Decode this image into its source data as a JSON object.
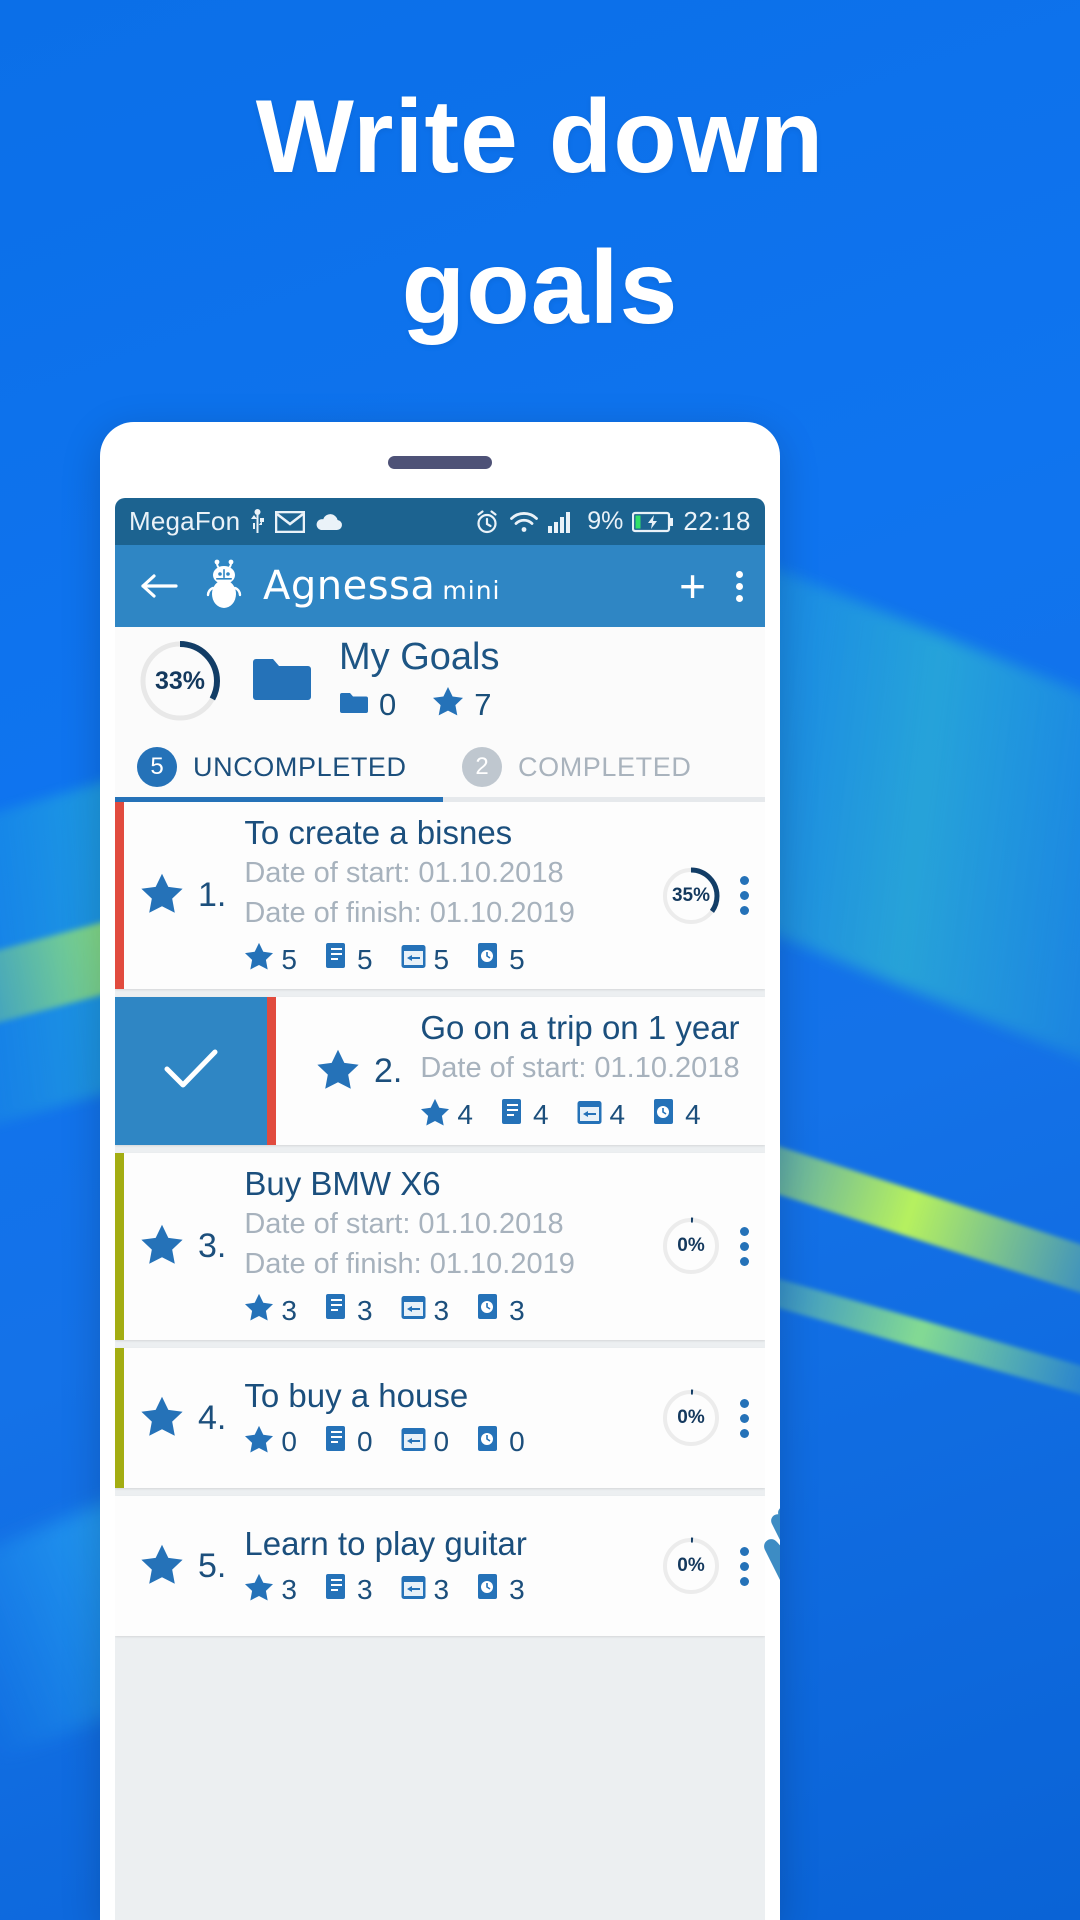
{
  "promo": {
    "headline_line1": "Write down",
    "headline_line2": "goals",
    "bg_color": "#0f74ef",
    "text_color": "#ffffff"
  },
  "statusbar": {
    "carrier": "MegaFon",
    "icons_left": [
      "usb-icon",
      "email-icon",
      "cloud-icon"
    ],
    "icons_right": [
      "alarm-icon",
      "wifi-icon",
      "signal-icon"
    ],
    "battery_percent": "9%",
    "battery_icon": "battery-charging-icon",
    "clock": "22:18",
    "bg_color": "#1c6390"
  },
  "appbar": {
    "back_icon": "back-arrow-icon",
    "logo_icon": "robot-logo-icon",
    "brand": "Agnessa",
    "brand_suffix": "mini",
    "add_label": "+",
    "overflow_icon": "overflow-menu-icon",
    "bg_color": "#2f86c4"
  },
  "goals_header": {
    "progress_percent": 33,
    "progress_label": "33%",
    "folder_icon": "folder-icon",
    "title": "My Goals",
    "subfolders_icon": "folder-icon",
    "subfolders_count": "0",
    "stars_icon": "star-icon",
    "stars_count": "7"
  },
  "tabs": [
    {
      "badge": "5",
      "label": "UNCOMPLETED",
      "active": true
    },
    {
      "badge": "2",
      "label": "COMPLETED",
      "active": false
    }
  ],
  "goals": [
    {
      "index": "1.",
      "title": "To create a bisnes",
      "date_start": "Date of start: 01.10.2018",
      "date_finish": "Date of finish: 01.10.2019",
      "counts": {
        "star": "5",
        "note": "5",
        "calendar": "5",
        "task": "5"
      },
      "progress_percent": 35,
      "progress_label": "35%",
      "edge_color": "red",
      "swiped": false
    },
    {
      "index": "2.",
      "title": "Go on a trip on 1 year",
      "date_start": "Date of start: 01.10.2018",
      "date_finish": "",
      "counts": {
        "star": "4",
        "note": "4",
        "calendar": "4",
        "task": "4"
      },
      "progress_percent": null,
      "progress_label": "",
      "edge_color": "red",
      "swiped": true,
      "swipe_action_icon": "check-icon"
    },
    {
      "index": "3.",
      "title": "Buy BMW X6",
      "date_start": "Date of start: 01.10.2018",
      "date_finish": "Date of finish: 01.10.2019",
      "counts": {
        "star": "3",
        "note": "3",
        "calendar": "3",
        "task": "3"
      },
      "progress_percent": 0,
      "progress_label": "0%",
      "edge_color": "olive",
      "swiped": false
    },
    {
      "index": "4.",
      "title": "To buy a house",
      "date_start": "",
      "date_finish": "",
      "counts": {
        "star": "0",
        "note": "0",
        "calendar": "0",
        "task": "0"
      },
      "progress_percent": 0,
      "progress_label": "0%",
      "edge_color": "olive",
      "swiped": false
    },
    {
      "index": "5.",
      "title": "Learn to play guitar",
      "date_start": "",
      "date_finish": "",
      "counts": {
        "star": "3",
        "note": "3",
        "calendar": "3",
        "task": "3"
      },
      "progress_percent": 0,
      "progress_label": "0%",
      "edge_color": "none",
      "swiped": false
    }
  ],
  "overlay": {
    "cursor_icon": "hand-tap-icon"
  },
  "colors": {
    "accent_blue": "#2572b8",
    "appbar_blue": "#2f86c4",
    "statusbar_blue": "#1c6390",
    "ring_dark": "#123d66",
    "muted_text": "#a7b2bd",
    "edge_red": "#e14b3e",
    "edge_olive": "#a3ad12"
  }
}
